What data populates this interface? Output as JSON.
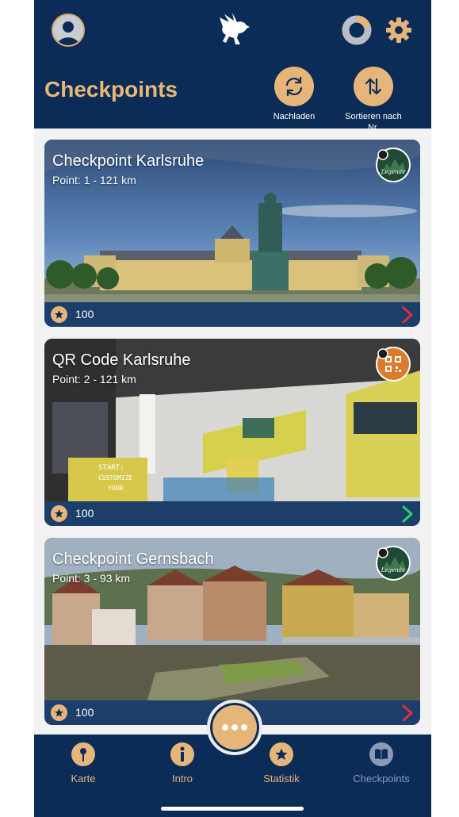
{
  "header": {
    "title": "Checkpoints",
    "reload_label": "Nachladen",
    "sort_label": "Sortieren nach Nr.",
    "progress_fraction": 0.2
  },
  "cards": [
    {
      "title": "Checkpoint Karlsruhe",
      "subtitle": "Point: 1 - 121 km",
      "points": "100",
      "badge": "Legende",
      "badge_type": "legend",
      "chevron_color": "#e0303a",
      "image": "karlsruhe-palace-photo"
    },
    {
      "title": "QR Code Karlsruhe",
      "subtitle": "Point: 2 - 121 km",
      "points": "100",
      "badge": "QR",
      "badge_type": "qr",
      "chevron_color": "#2bd35a",
      "image": "showroom-interior-photo",
      "image_caption": "START:\nCUSTOMIZE\nYOUR"
    },
    {
      "title": "Checkpoint Gernsbach",
      "subtitle": "Point: 3 - 93 km",
      "points": "100",
      "badge": "Legende",
      "badge_type": "legend",
      "chevron_color": "#e0303a",
      "image": "gernsbach-river-photo"
    }
  ],
  "nav": {
    "items": [
      {
        "label": "Karte",
        "icon": "map-pin-icon",
        "active": true
      },
      {
        "label": "Intro",
        "icon": "info-icon",
        "active": true
      },
      {
        "label": "Statistik",
        "icon": "star-icon",
        "active": true
      },
      {
        "label": "Checkpoints",
        "icon": "book-icon",
        "active": false
      }
    ],
    "more_icon": "more-dots-icon"
  },
  "colors": {
    "navy": "#0b2c57",
    "gold": "#e5b57a",
    "title_gold": "#e8b877",
    "inactive": "#8b9bb5"
  }
}
